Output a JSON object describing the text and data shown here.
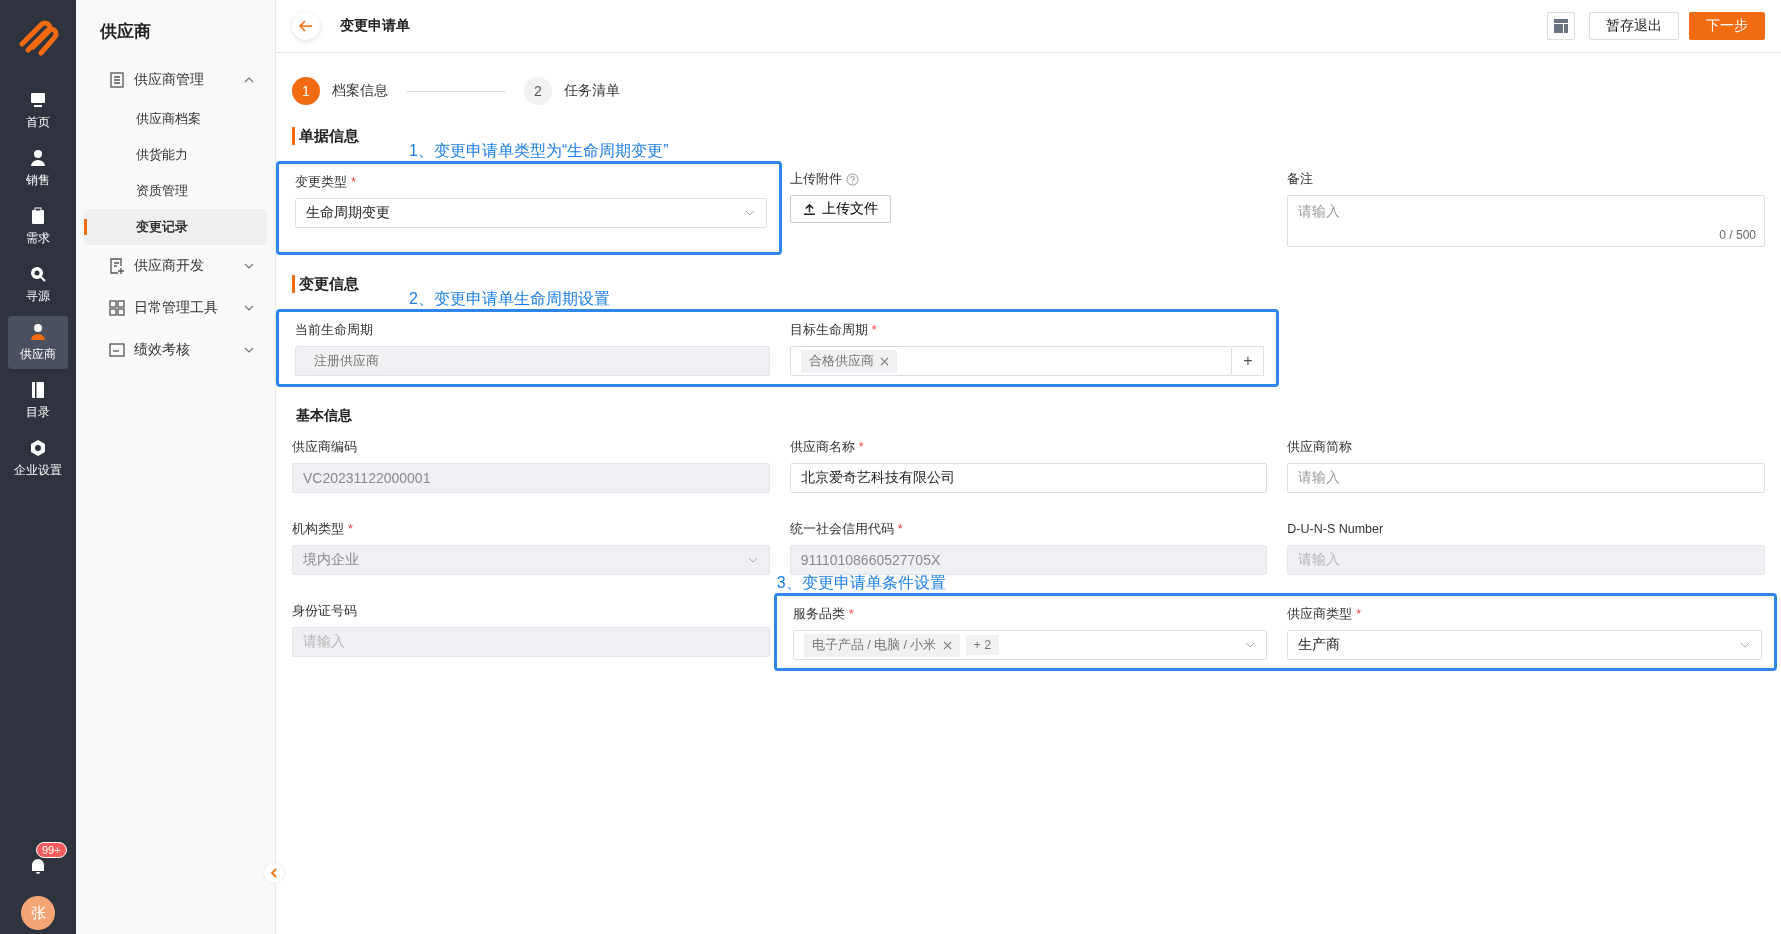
{
  "rail": {
    "items": [
      {
        "label": "首页",
        "selected": false
      },
      {
        "label": "销售",
        "selected": false
      },
      {
        "label": "需求",
        "selected": false
      },
      {
        "label": "寻源",
        "selected": false
      },
      {
        "label": "供应商",
        "selected": true
      },
      {
        "label": "目录",
        "selected": false
      },
      {
        "label": "企业设置",
        "selected": false
      }
    ],
    "badge": "99+",
    "avatar": "张"
  },
  "sidebar": {
    "title": "供应商",
    "groups": [
      {
        "label": "供应商管理",
        "expanded": true,
        "children": [
          {
            "label": "供应商档案",
            "selected": false
          },
          {
            "label": "供货能力",
            "selected": false
          },
          {
            "label": "资质管理",
            "selected": false
          },
          {
            "label": "变更记录",
            "selected": true
          }
        ]
      },
      {
        "label": "供应商开发",
        "expanded": false
      },
      {
        "label": "日常管理工具",
        "expanded": false
      },
      {
        "label": "绩效考核",
        "expanded": false
      }
    ]
  },
  "header": {
    "title": "变更申请单",
    "buttons": [
      {
        "label": "暂存退出",
        "kind": "default"
      },
      {
        "label": "下一步",
        "kind": "primary"
      }
    ]
  },
  "steps": [
    {
      "number": "1",
      "label": "档案信息",
      "selected": true
    },
    {
      "number": "2",
      "label": "任务清单",
      "selected": false
    }
  ],
  "sections": [
    {
      "title": "单据信息",
      "kind": "main",
      "rows": [
        [
          {
            "kind": "frame",
            "note": "1、变更申请单类型为“生命周期变更”",
            "fields": [
              {
                "label": "变更类型",
                "mark": "*",
                "kind": "select",
                "value": "生命周期变更",
                "disabled": false
              }
            ]
          },
          {
            "label": "上传附件",
            "kind": "upload",
            "button": "上传文件"
          },
          {
            "label": "备注",
            "kind": "textarea",
            "placeholder": "请输入",
            "counter": "0 / 500"
          }
        ]
      ]
    },
    {
      "title": "变更信息",
      "kind": "main",
      "rows": [
        [
          {
            "kind": "frame",
            "note": "2、变更申请单生命周期设置",
            "fields": [
              {
                "label": "当前生命周期",
                "kind": "tags",
                "disabled": true,
                "tags": [
                  {
                    "text": "注册供应商",
                    "removable": false
                  }
                ]
              },
              {
                "label": "目标生命周期",
                "mark": "*",
                "kind": "tags",
                "disabled": false,
                "tags": [
                  {
                    "text": "合格供应商",
                    "removable": true
                  }
                ],
                "add": "+"
              }
            ]
          }
        ]
      ]
    },
    {
      "title": "基本信息",
      "kind": "sub",
      "rows": [
        [
          {
            "label": "供应商编码",
            "kind": "input",
            "value": "VC20231122000001",
            "disabled": true
          },
          {
            "label": "供应商名称",
            "mark": "*",
            "kind": "input",
            "value": "北京爱奇艺科技有限公司",
            "disabled": false
          },
          {
            "label": "供应商简称",
            "kind": "input",
            "placeholder": "请输入",
            "disabled": false
          }
        ],
        [
          {
            "label": "机构类型",
            "mark": "*",
            "kind": "select",
            "value": "境内企业",
            "disabled": true
          },
          {
            "label": "统一社会信用代码",
            "mark": "*",
            "kind": "input",
            "value": "91110108660527705X",
            "disabled": true
          },
          {
            "label": "D-U-N-S Number",
            "kind": "input",
            "placeholder": "请输入",
            "disabled": true
          }
        ],
        [
          {
            "label": "身份证号码",
            "kind": "input",
            "placeholder": "请输入",
            "disabled": true
          },
          {
            "kind": "frame",
            "note": "3、变更申请单条件设置",
            "fields": [
              {
                "label": "服务品类",
                "mark": "*",
                "kind": "select",
                "disabled": false,
                "tags": [
                  {
                    "text": "电子产品 / 电脑 / 小米",
                    "removable": true
                  },
                  {
                    "text": "+ 2",
                    "removable": false
                  }
                ]
              },
              {
                "label": "供应商类型",
                "mark": "*",
                "kind": "select",
                "value": "生产商",
                "disabled": false
              }
            ]
          }
        ]
      ]
    }
  ]
}
